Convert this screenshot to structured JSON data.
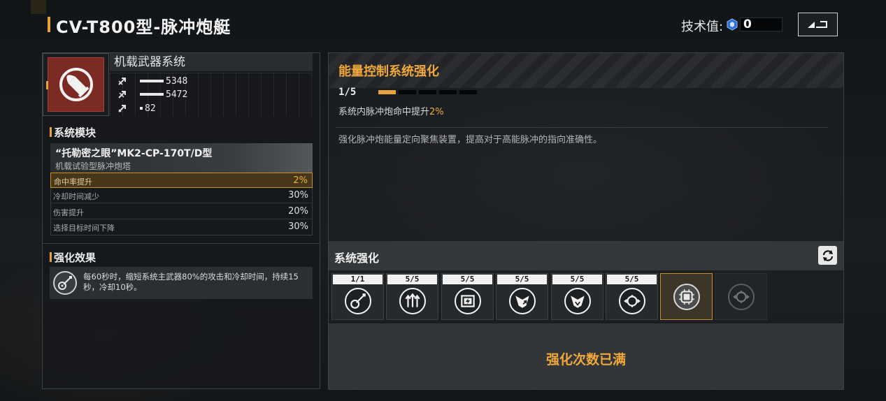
{
  "header": {
    "title": "CV-T800型-脉冲炮艇",
    "tech_label": "技术值:",
    "tech_value": "0"
  },
  "weapon": {
    "system_name": "机载武器系统",
    "icon": "bullet-icon",
    "stats": [
      {
        "icon": "attack-arrow-icon",
        "value": "5348"
      },
      {
        "icon": "defense-arrow-icon",
        "value": "5472"
      },
      {
        "icon": "speed-arrow-icon",
        "value": "82"
      }
    ]
  },
  "module": {
    "section_title": "系统模块",
    "name": "“托勒密之眼”MK2-CP-170T/D型",
    "subtitle": "机载试验型脉冲炮塔",
    "stats": [
      {
        "label": "命中率提升",
        "value": "2%"
      },
      {
        "label": "冷却时间减少",
        "value": "30%"
      },
      {
        "label": "伤害提升",
        "value": "20%"
      },
      {
        "label": "选择目标时间下降",
        "value": "30%"
      }
    ]
  },
  "effect": {
    "section_title": "强化效果",
    "icon": "guitar-icon",
    "text": "每60秒时，缩短系统主武器80%的攻击和冷却时间，持续15秒，冷却10秒。"
  },
  "enhancement": {
    "title": "能量控制系统强化",
    "progress": "1/5",
    "levels_total": 5,
    "levels_filled": 1,
    "effect_prefix": "系统内脉冲炮命中提升",
    "effect_value": "2%",
    "description": "强化脉冲炮能量定向聚焦装置，提高对于高能脉冲的指向准确性。"
  },
  "system_upgrades": {
    "title": "系统强化",
    "slots": [
      {
        "badge": "1/1",
        "icon": "guitar-icon",
        "state": "normal"
      },
      {
        "badge": "5/5",
        "icon": "triple-arrow-up-icon",
        "state": "normal"
      },
      {
        "badge": "5/5",
        "icon": "battery-icon",
        "state": "normal"
      },
      {
        "badge": "5/5",
        "icon": "shield-up-icon",
        "state": "normal"
      },
      {
        "badge": "5/5",
        "icon": "shield-down-icon",
        "state": "normal"
      },
      {
        "badge": "5/5",
        "icon": "crosshair-icon",
        "state": "normal"
      },
      {
        "badge": "",
        "icon": "chip-icon",
        "state": "selected"
      },
      {
        "badge": "",
        "icon": "crosshair-icon",
        "state": "locked"
      }
    ],
    "status": "强化次数已满"
  },
  "colors": {
    "accent": "#e6a23c",
    "panel": "#2c2f32",
    "weapon_red": "#7c2a24"
  }
}
